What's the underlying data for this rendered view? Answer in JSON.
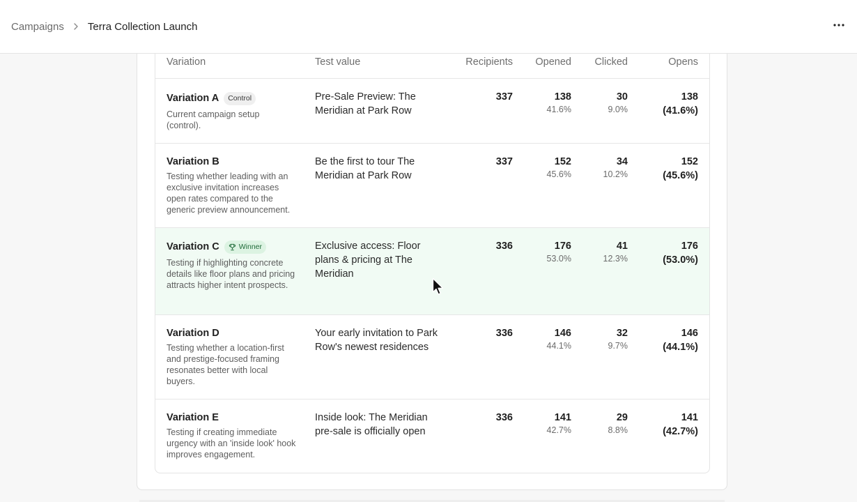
{
  "breadcrumb": {
    "root": "Campaigns",
    "current": "Terra Collection Launch"
  },
  "table": {
    "headers": {
      "variation": "Variation",
      "test_value": "Test value",
      "recipients": "Recipients",
      "opened": "Opened",
      "clicked": "Clicked",
      "opens": "Opens"
    },
    "rows": [
      {
        "name": "Variation A",
        "badge": "Control",
        "description": "Current campaign setup (control).",
        "test_value": "Pre-Sale Preview: The Meridian at Park Row",
        "recipients": "337",
        "opened": "138",
        "opened_pct": "41.6%",
        "clicked": "30",
        "clicked_pct": "9.0%",
        "opens": "138",
        "opens_pct": "(41.6%)"
      },
      {
        "name": "Variation B",
        "badge": "",
        "description": "Testing whether leading with an exclusive invitation increases open rates compared to the generic preview announcement.",
        "test_value": "Be the first to tour The Meridian at Park Row",
        "recipients": "337",
        "opened": "152",
        "opened_pct": "45.6%",
        "clicked": "34",
        "clicked_pct": "10.2%",
        "opens": "152",
        "opens_pct": "(45.6%)"
      },
      {
        "name": "Variation C",
        "badge": "Winner",
        "description": "Testing if highlighting concrete details like floor plans and pricing attracts higher intent prospects.",
        "test_value": "Exclusive access: Floor plans & pricing at The Meridian",
        "recipients": "336",
        "opened": "176",
        "opened_pct": "53.0%",
        "clicked": "41",
        "clicked_pct": "12.3%",
        "opens": "176",
        "opens_pct": "(53.0%)"
      },
      {
        "name": "Variation D",
        "badge": "",
        "description": "Testing whether a location-first and prestige-focused framing resonates better with local buyers.",
        "test_value": "Your early invitation to Park Row's newest residences",
        "recipients": "336",
        "opened": "146",
        "opened_pct": "44.1%",
        "clicked": "32",
        "clicked_pct": "9.7%",
        "opens": "146",
        "opens_pct": "(44.1%)"
      },
      {
        "name": "Variation E",
        "badge": "",
        "description": "Testing if creating immediate urgency with an 'inside look' hook improves engagement.",
        "test_value": "Inside look: The Meridian pre-sale is officially open",
        "recipients": "336",
        "opened": "141",
        "opened_pct": "42.7%",
        "clicked": "29",
        "clicked_pct": "8.8%",
        "opens": "141",
        "opens_pct": "(42.7%)"
      }
    ]
  },
  "icons": {
    "more": "more-horizontal-icon",
    "chevron": "chevron-right-icon",
    "trophy": "trophy-icon",
    "cursor": "mouse-pointer-icon"
  },
  "colors": {
    "winner_row_bg": "#f1fbf4",
    "winner_badge_bg": "#dcf3e2",
    "winner_badge_text": "#1f6b39",
    "control_badge_bg": "#efefef"
  }
}
